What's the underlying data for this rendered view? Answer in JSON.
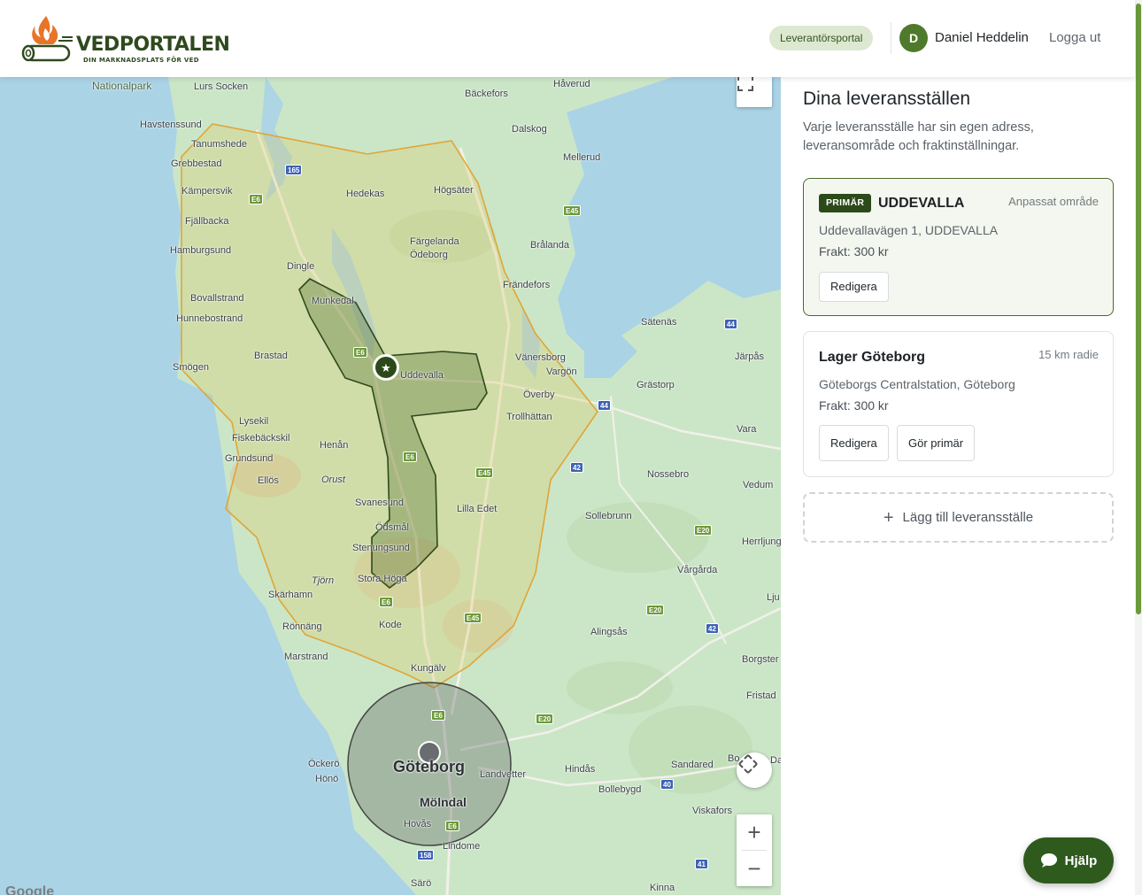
{
  "header": {
    "logo_title": "VEDPORTALEN",
    "logo_subtitle": "DIN MARKNADSPLATS FÖR VED",
    "portal_label": "Leverantörsportal",
    "user_initial": "D",
    "user_name": "Daniel Heddelin",
    "logout_label": "Logga ut"
  },
  "map": {
    "labels": {
      "nationalpark": "Nationalpark",
      "lurs_socken": "Lurs Socken",
      "havstenssund": "Havstenssund",
      "tanumshede": "Tanumshede",
      "grebbestad": "Grebbestad",
      "kampersvik": "Kämpersvik",
      "fjallbacka": "Fjällbacka",
      "hamburgsund": "Hamburgsund",
      "bovallstrand": "Bovallstrand",
      "hunnebostrand": "Hunnebostrand",
      "smogen": "Smögen",
      "brastad": "Brastad",
      "lysekil": "Lysekil",
      "fiskebackskil": "Fiskebäckskil",
      "grundsund": "Grundsund",
      "ellos": "Ellös",
      "henan": "Henån",
      "orust": "Orust",
      "tjorn": "Tjörn",
      "skarhamn": "Skärhamn",
      "ronnang": "Rönnäng",
      "marstrand": "Marstrand",
      "ockero": "Öckerö",
      "hono": "Hönö",
      "backefors": "Bäckefors",
      "haverud": "Håverud",
      "dalskog": "Dalskog",
      "mellerud": "Mellerud",
      "hedekas": "Hedekas",
      "hogsater": "Högsäter",
      "fargelanda": "Färgelanda",
      "odeborg": "Ödeborg",
      "bralanda": "Brålanda",
      "dingle": "Dingle",
      "munkedal": "Munkedal",
      "frandefors": "Frändefors",
      "satenas": "Sätenäs",
      "uddevalla": "Uddevalla",
      "vanersborg": "Vänersborg",
      "vargon": "Vargön",
      "overby": "Överby",
      "grastorp": "Grästorp",
      "jarpas": "Järpås",
      "trollhattan": "Trollhättan",
      "vara": "Vara",
      "nossebro": "Nossebro",
      "vedum": "Vedum",
      "svanesund": "Svanesund",
      "lilla_edet": "Lilla Edet",
      "sollebrunn": "Sollebrunn",
      "odsmal": "Ödsmål",
      "stenungsund": "Stenungsund",
      "herrljunga": "Herrljung",
      "stora_hoga": "Stora Höga",
      "vargarda": "Vårgårda",
      "kode": "Kode",
      "alingsas": "Alingsås",
      "ljung": "Lju",
      "kungalv": "Kungälv",
      "borgstena": "Borgster",
      "fristad": "Fristad",
      "goteborg": "Göteborg",
      "landvetter": "Landvetter",
      "hindas": "Hindås",
      "sandared": "Sandared",
      "bollebygd": "Bollebygd",
      "molndal": "Mölndal",
      "hovas": "Hovås",
      "viskafors": "Viskafors",
      "lindome": "Lindome",
      "saro": "Särö",
      "kinna": "Kinna",
      "bo": "Bo",
      "da": "Da"
    },
    "google_label": "Google",
    "zoom_in": "+",
    "zoom_out": "−"
  },
  "panel": {
    "title": "Dina leveransställen",
    "description": "Varje leveransställe har sin egen adress, leveransområde och fraktinställningar.",
    "locations": [
      {
        "badge": "PRIMÄR",
        "name": "UDDEVALLA",
        "area_tag": "Anpassat område",
        "address": "Uddevallavägen 1, UDDEVALLA",
        "freight": "Frakt: 300 kr",
        "edit_label": "Redigera"
      },
      {
        "name": "Lager Göteborg",
        "area_tag": "15 km radie",
        "address": "Göteborgs Centralstation, Göteborg",
        "freight": "Frakt: 300 kr",
        "edit_label": "Redigera",
        "make_primary_label": "Gör primär"
      }
    ],
    "add_label": "Lägg till leveransställe"
  },
  "help": {
    "label": "Hjälp"
  },
  "colors": {
    "brand_green": "#2c4a19",
    "accent_green": "#4f7a2b",
    "area_outline": "#e0a537",
    "flame_orange": "#e8742a"
  }
}
